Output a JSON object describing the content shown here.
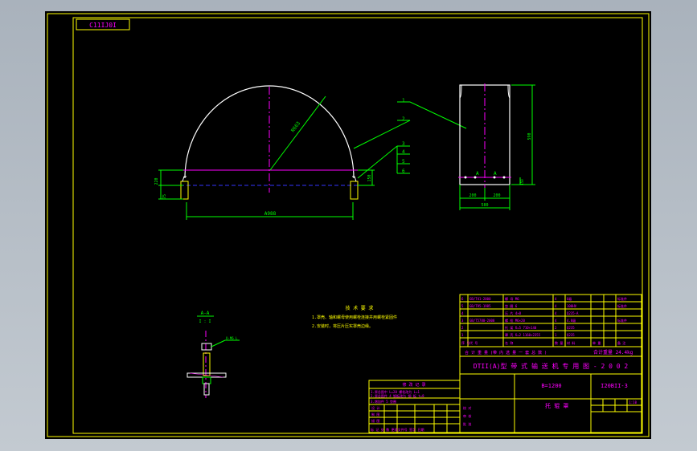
{
  "sheet_code": "C11IJ0I",
  "drawing": {
    "dims": {
      "radius": "R663",
      "span": "A988",
      "height": "590",
      "side_left_top": "220",
      "side_left_bottom": "75",
      "side_right": "150",
      "width_total": "580",
      "width_a": "200",
      "width_b": "200",
      "side_right_small": "150"
    },
    "section_marks": [
      "A",
      "A"
    ],
    "callouts": [
      "1",
      "2",
      "3",
      "4",
      "5",
      "6"
    ],
    "section_view": {
      "title": "A-A",
      "subtitle": "I : I",
      "note": "U-M6 L"
    }
  },
  "tech_requirements": {
    "title": "技 术 要 求",
    "lines": [
      "1.罩壳、轴和螺母使用螺栓连接并用螺栓紧固件",
      "2.安装时，将压片压实罩壳边缘。"
    ]
  },
  "title_block": {
    "title": "DTII(A)型  带 式 输 送 机 专 用 图 - 2 0 0 2",
    "size": "B=1200",
    "drawing_no": "I20BII-3",
    "name": "托 辊 罩",
    "weight": "合计重量  24.4kg",
    "total_row": "合 计 重 量  (带 内 选 量 一 套 总 数 )",
    "header": [
      "序 号",
      "代  号",
      "名  称",
      "数 量",
      "材  料",
      "单 重",
      "备 注"
    ],
    "parts": [
      [
        "6",
        "GB/T41-2000",
        "螺 母 M6",
        "4",
        "6级",
        "",
        "标准件"
      ],
      [
        "5",
        "GB/T95-1985",
        "垫 圈 6",
        "4",
        "100HV",
        "",
        "标准件"
      ],
      [
        "4",
        "",
        "压 片 4×8",
        "4",
        "Q235-A",
        "",
        ""
      ],
      [
        "3",
        "GB/T5780-2000",
        "螺 栓 M6×20",
        "4",
        "4.8级",
        "",
        "标准件"
      ],
      [
        "2",
        "",
        "托 架 δ=5 710×140",
        "2",
        "Q235",
        "",
        ""
      ],
      [
        "1",
        "",
        "罩 壳 δ=2 1160×2355",
        "1",
        "Q235",
        "",
        ""
      ]
    ],
    "change_title": "修 改 记 录",
    "change_rows": [
      "1.原总图中 L=20 螺栓改为 L=1",
      "2.原总图件 4 钢板改为 钢 板 t=8",
      "3.增加件 5 垫圈",
      "标 记   处 数   更改文件号   签字   日期"
    ],
    "sign_labels": [
      "设 计",
      "制 图",
      "描 图",
      "校 对",
      "审 核",
      "批 准"
    ],
    "scale": "1:10"
  },
  "colors": {
    "border": "#ffff00",
    "outline": "#ffffff",
    "dimension": "#00ff00",
    "center": "#ff00ff",
    "hidden": "#3333ff",
    "table_text": "#ff00ff",
    "background": "#000000"
  }
}
